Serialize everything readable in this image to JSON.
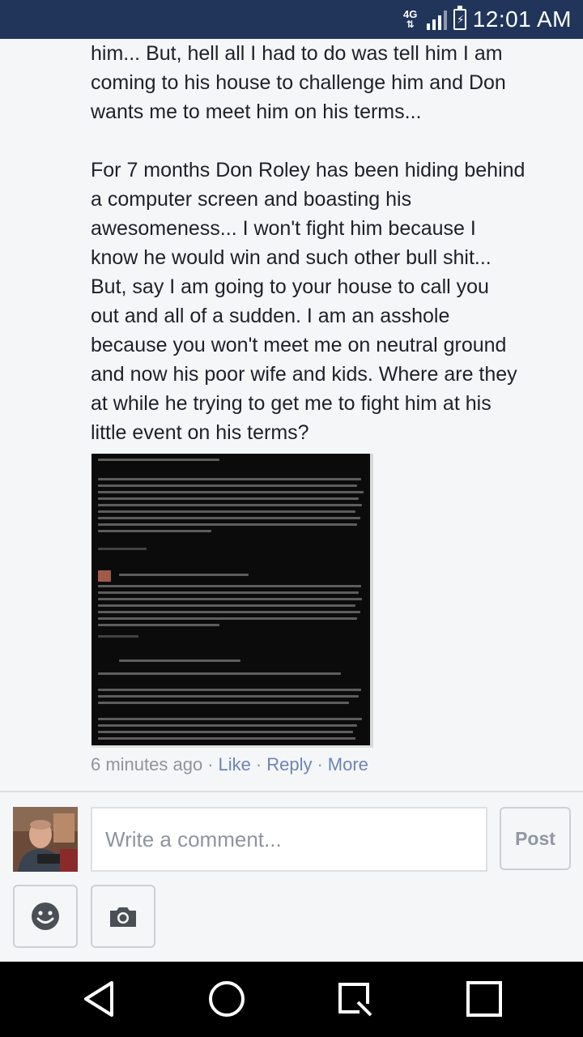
{
  "status_bar": {
    "network": "4G",
    "time": "12:01 AM"
  },
  "comment": {
    "text": "him... But, hell all I had to do was tell him I am\ncoming to his house to challenge him and Don\nwants me to meet him on his terms...\n\nFor 7 months Don Roley has been hiding behind\na computer screen and boasting his\nawesomeness... I won't fight him because I\nknow he would win and such other bull shit...\nBut, say I am going to your house to call you\nout and all of a sudden. I am an asshole\nbecause you won't meet me on neutral ground\nand now his poor wife and kids. Where are they\nat while he trying to get me to fight him at his\nlittle event on his terms?",
    "timestamp": "6 minutes ago",
    "actions": {
      "like": "Like",
      "reply": "Reply",
      "more": "More"
    }
  },
  "composer": {
    "placeholder": "Write a comment...",
    "post_label": "Post",
    "emoji_icon": "smiley-icon",
    "camera_icon": "camera-icon"
  },
  "nav_bar": {
    "icons": [
      "back-icon",
      "home-icon",
      "recent-apps-icon",
      "overview-icon"
    ]
  },
  "colors": {
    "status_bar": "#21355b",
    "link": "#6d84b4",
    "meta": "#90949c",
    "icon": "#4b4f56"
  }
}
